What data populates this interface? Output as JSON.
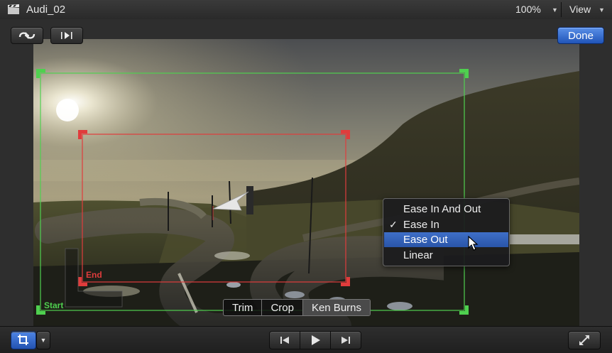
{
  "titlebar": {
    "title": "Audi_02",
    "zoom": "100%",
    "view_label": "View"
  },
  "toolbar": {
    "done_label": "Done"
  },
  "viewer": {
    "start_label": "Start",
    "end_label": "End",
    "start_color": "#4fd04f",
    "end_color": "#e03c3c"
  },
  "segmented": {
    "items": [
      "Trim",
      "Crop",
      "Ken Burns"
    ],
    "selected": "Ken Burns"
  },
  "ease_menu": {
    "items": [
      {
        "label": "Ease In And Out",
        "checked": false,
        "highlighted": false
      },
      {
        "label": "Ease In",
        "checked": true,
        "highlighted": false
      },
      {
        "label": "Ease Out",
        "checked": false,
        "highlighted": true
      },
      {
        "label": "Linear",
        "checked": false,
        "highlighted": false
      }
    ],
    "check_glyph": "✓"
  },
  "colors": {
    "accent": "#2f63c0",
    "menu_highlight": "#3463b8"
  }
}
